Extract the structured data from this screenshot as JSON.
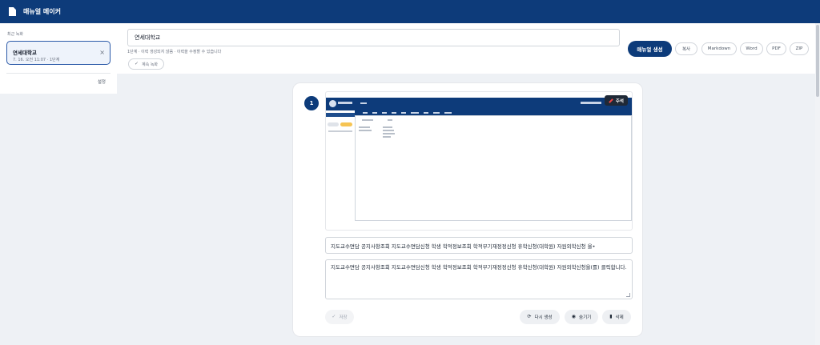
{
  "app": {
    "title": "매뉴얼 메이커",
    "icon": "document-icon"
  },
  "sidebar": {
    "recent_label": "최근 녹화",
    "items": [
      {
        "title": "연세대학교",
        "meta": "7. 16. 오전 11:07 · 1단계"
      }
    ],
    "settings_label": "설정"
  },
  "header": {
    "manual_name": "연세대학교",
    "hint": "1단계 · 이력 생성되지 않음 · 이력을 수정할 수 있습니다",
    "continue_label": "계속 녹화",
    "generate_label": "매뉴얼 생성",
    "exports": [
      "복사",
      "Markdown",
      "Word",
      "PDF",
      "ZIP"
    ]
  },
  "step": {
    "number": "1",
    "annotate_label": "주석",
    "short_text": "지도교수면담 공지사항조회 지도교수면담신청 학생 학적정보조회 학적부기재정정신청 휴학신청(대학원) 자원외학신청 을•",
    "long_text": "지도교수면담 공지사항조회 지도교수면담신청 학생 학적정보조회 학적부기재정정신청 휴학신청(대학원) 자원외학신청을(를) 클릭합니다.",
    "save_label": "저장",
    "regenerate_label": "다시 생성",
    "hide_label": "숨기기",
    "delete_label": "삭제"
  },
  "colors": {
    "primary": "#0d3b7a",
    "accent_border": "#2b5aa8",
    "background": "#eef1f5"
  }
}
